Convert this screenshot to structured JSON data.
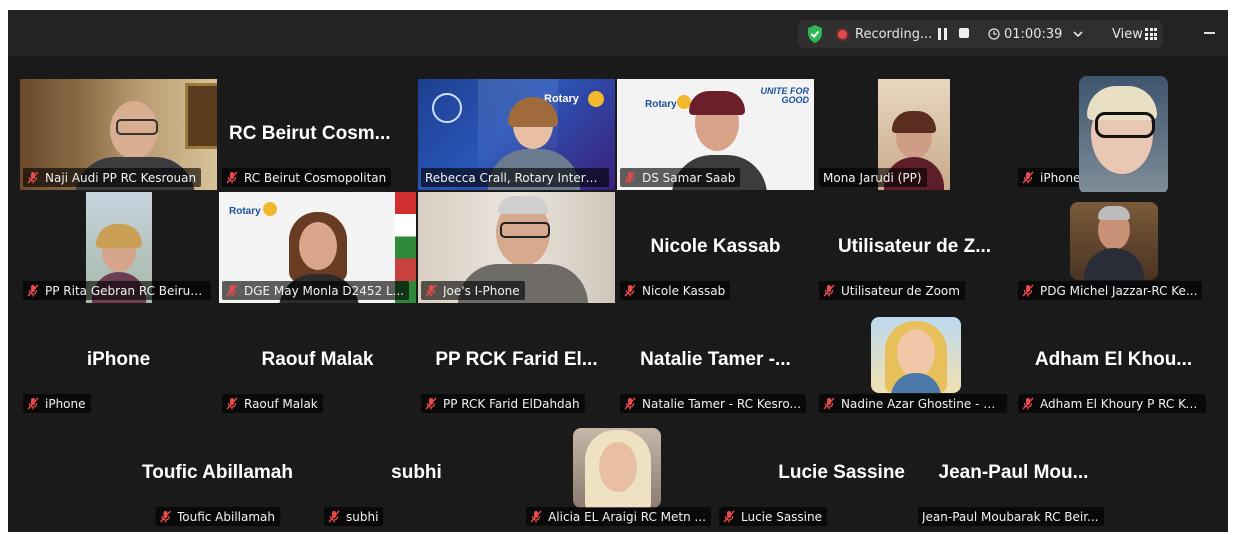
{
  "toolbar": {
    "recording_label": "Recording...",
    "timer": "01:00:39",
    "view_label": "View",
    "colors": {
      "shield": "#2fb757",
      "record": "#e24b4b",
      "active_speaker": "#3fbf5a"
    }
  },
  "icons": {
    "shield": "shield-check-icon",
    "record": "record-dot-icon",
    "pause": "pause-icon",
    "stop": "stop-icon",
    "clock": "clock-icon",
    "chevron": "chevron-down-icon",
    "grid": "grid-view-icon",
    "minimize": "minimize-icon",
    "mic_muted": "mic-muted-icon"
  },
  "participants": [
    {
      "label": "Naji Audi PP RC Kesrouan",
      "big_name": "",
      "muted": true
    },
    {
      "label": "RC Beirut Cosmopolitan",
      "big_name": "RC Beirut Cosm...",
      "muted": true
    },
    {
      "label": "Rebecca Crall, Rotary Interna...",
      "big_name": "",
      "muted": false,
      "active": true,
      "slide_text": "Rotary"
    },
    {
      "label": "DS Samar Saab",
      "big_name": "",
      "muted": true,
      "slide_text": "Rotary",
      "slide_text2": "UNITE FOR GOOD"
    },
    {
      "label": "Mona Jarudi (PP)",
      "big_name": "",
      "muted": false
    },
    {
      "label": "iPhone",
      "big_name": "",
      "muted": true
    },
    {
      "label": "PP Rita Gebran RC Beirut ...",
      "big_name": "",
      "muted": true
    },
    {
      "label": "DGE May Monla D2452 L...",
      "big_name": "",
      "muted": true,
      "slide_text": "Rotary"
    },
    {
      "label": "Joe's I-Phone",
      "big_name": "",
      "muted": true
    },
    {
      "label": "Nicole Kassab",
      "big_name": "Nicole Kassab",
      "muted": true
    },
    {
      "label": "Utilisateur de Zoom",
      "big_name": "Utilisateur de Z...",
      "muted": true
    },
    {
      "label": "PDG Michel Jazzar-RC Ke...",
      "big_name": "",
      "muted": true
    },
    {
      "label": "iPhone",
      "big_name": "iPhone",
      "muted": true
    },
    {
      "label": "Raouf Malak",
      "big_name": "Raouf Malak",
      "muted": true
    },
    {
      "label": "PP RCK Farid ElDahdah",
      "big_name": "PP RCK Farid El...",
      "muted": true
    },
    {
      "label": "Natalie Tamer - RC Kesro...",
      "big_name": "Natalie Tamer -...",
      "muted": true
    },
    {
      "label": "Nadine Azar Ghostine - R...",
      "big_name": "",
      "muted": true
    },
    {
      "label": "Adham El Khoury P RC Ke...",
      "big_name": "Adham El Khou...",
      "muted": true
    },
    {
      "label": "Toufic Abillamah",
      "big_name": "Toufic Abillamah",
      "muted": true
    },
    {
      "label": "subhi",
      "big_name": "subhi",
      "muted": true
    },
    {
      "label": "Alicia EL Araigi RC Metn ...",
      "big_name": "",
      "muted": true
    },
    {
      "label": "Lucie Sassine",
      "big_name": "Lucie Sassine",
      "muted": true
    },
    {
      "label": "Jean-Paul Moubarak RC Beir...",
      "big_name": "Jean-Paul  Mou...",
      "muted": false
    }
  ]
}
